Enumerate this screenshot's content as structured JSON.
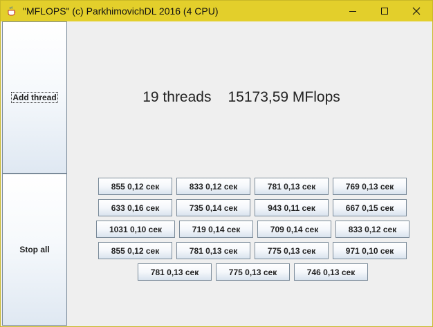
{
  "window": {
    "title": "\"MFLOPS\" (c) ParkhimovichDL 2016 (4 CPU)"
  },
  "sidebar": {
    "add_label": "Add thread",
    "stop_label": "Stop all"
  },
  "stats": {
    "threads": "19 threads",
    "mflops": "15173,59 MFlops"
  },
  "threads": [
    "855  0,12 сек",
    "833  0,12 сек",
    "781  0,13 сек",
    "769  0,13 сек",
    "633  0,16 сек",
    "735  0,14 сек",
    "943  0,11 сек",
    "667  0,15 сек",
    "1031  0,10 сек",
    "719  0,14 сек",
    "709  0,14 сек",
    "833  0,12 сек",
    "855  0,12 сек",
    "781  0,13 сек",
    "775  0,13 сек",
    "971  0,10 сек",
    "781  0,13 сек",
    "775  0,13 сек",
    "746  0,13 сек"
  ],
  "colors": {
    "titlebar": "#e3cf2b",
    "button_border": "#7a8a99"
  }
}
